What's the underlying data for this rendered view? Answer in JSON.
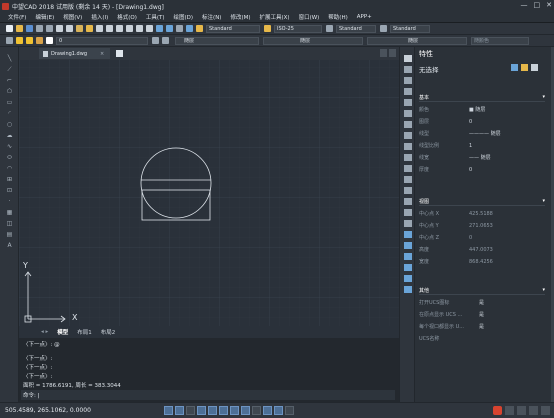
{
  "window": {
    "title": "中望CAD 2018 试用版 (剩余 14 天) - [Drawing1.dwg]",
    "controls": [
      "—",
      "□",
      "✕"
    ]
  },
  "menu": [
    "文件(F)",
    "编辑(E)",
    "视图(V)",
    "插入(I)",
    "格式(O)",
    "工具(T)",
    "绘图(D)",
    "标注(N)",
    "修改(M)",
    "扩展工具(X)",
    "窗口(W)",
    "帮助(H)",
    "APP+"
  ],
  "toolbar1": {
    "text_style": "Standard",
    "dim_style": "ISO-25",
    "table_style": "Standard",
    "multileader_style": "Standard"
  },
  "toolbar2": {
    "layer": "0",
    "color": "随层",
    "linetype": "随层",
    "lineweight": "随层",
    "plotstyle": "随颜色"
  },
  "doc": {
    "tab_label": "Drawing1.dwg",
    "close": "×"
  },
  "layout_tabs": {
    "model": "模型",
    "layout1": "布局1",
    "layout2": "布局2"
  },
  "ucs": {
    "x": "X",
    "y": "Y"
  },
  "command": {
    "lines": [
      "〈下一点〉: @",
      "〈下一点〉:",
      "〈下一点〉:",
      "〈下一点〉:",
      "面积 = 1786.6191, 周长 = 383.3044"
    ],
    "prompt": "命令: |"
  },
  "properties": {
    "title": "特性",
    "selection": "无选择",
    "sections": [
      {
        "name": "基本",
        "rows": [
          {
            "k": "颜色",
            "v": "■ 随层"
          },
          {
            "k": "图层",
            "v": "0"
          },
          {
            "k": "线型",
            "v": "———— 随层"
          },
          {
            "k": "线型比例",
            "v": "1"
          },
          {
            "k": "线宽",
            "v": "—— 随层"
          },
          {
            "k": "厚度",
            "v": "0"
          }
        ]
      },
      {
        "name": "视图",
        "rows": [
          {
            "k": "中心点 X",
            "v": "425.5188"
          },
          {
            "k": "中心点 Y",
            "v": "271.0653"
          },
          {
            "k": "中心点 Z",
            "v": "0"
          },
          {
            "k": "高度",
            "v": "447.0073"
          },
          {
            "k": "宽度",
            "v": "868.4256"
          }
        ]
      },
      {
        "name": "其他",
        "rows": [
          {
            "k": "打开UCS图标",
            "v": "是"
          },
          {
            "k": "在原点显示 UCS ...",
            "v": "是"
          },
          {
            "k": "每个视口都显示 U...",
            "v": "是"
          },
          {
            "k": "UCS名称",
            "v": ""
          }
        ]
      }
    ]
  },
  "status": {
    "coords": "505.4589, 265.1062, 0.0000"
  },
  "colors": {
    "accent": "#4d6f96",
    "canvas": "#2a313a",
    "panel": "#2b3138"
  }
}
